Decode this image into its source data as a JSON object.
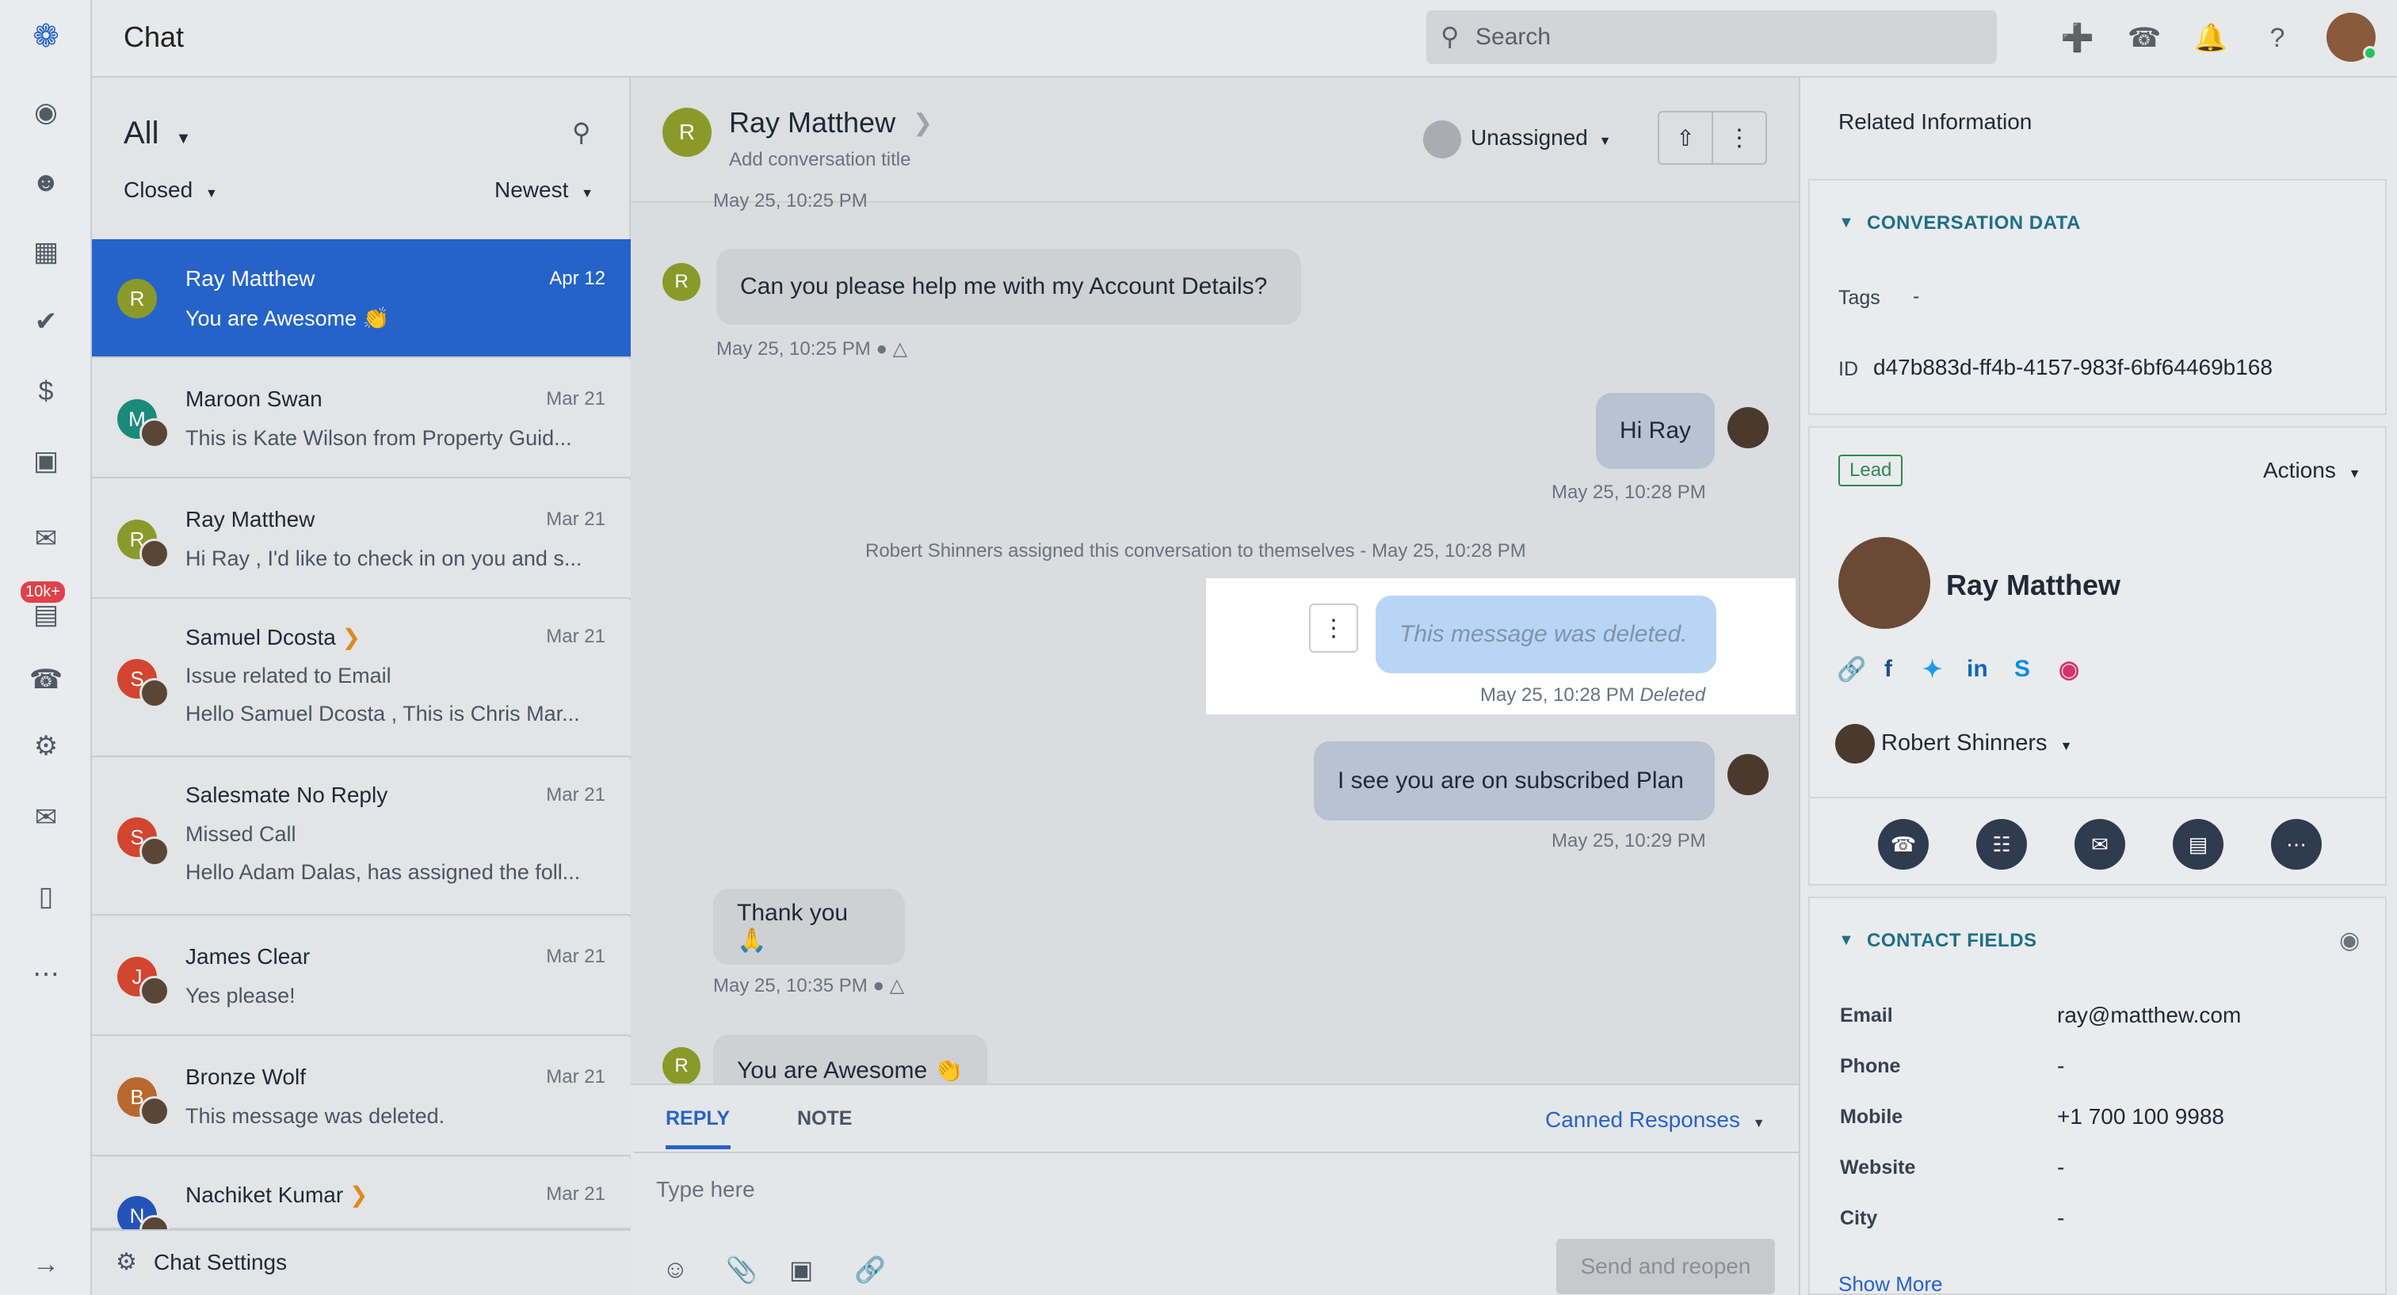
{
  "app": {
    "title": "Chat"
  },
  "search": {
    "placeholder": "Search"
  },
  "rail": {
    "badge": "10k+"
  },
  "list": {
    "filter": "All",
    "status": "Closed",
    "sort": "Newest",
    "settings": "Chat Settings",
    "items": [
      {
        "initial": "R",
        "name": "Ray Matthew",
        "date": "Apr 12",
        "line1": "You are Awesome 👏",
        "line2": "",
        "color": "#8a9a2a"
      },
      {
        "initial": "M",
        "name": "Maroon Swan",
        "date": "Mar 21",
        "line1": "This is Kate Wilson from Property Guid...",
        "line2": "",
        "color": "#1b8a7a"
      },
      {
        "initial": "R",
        "name": "Ray Matthew",
        "date": "Mar 21",
        "line1": "Hi Ray , I'd like to check in on you and s...",
        "line2": "",
        "color": "#8a9a2a"
      },
      {
        "initial": "S",
        "name": "Samuel Dcosta",
        "date": "Mar 21",
        "line1": "Issue related to Email",
        "line2": "Hello Samuel Dcosta , This is Chris Mar...",
        "color": "#d2452f"
      },
      {
        "initial": "S",
        "name": "Salesmate No Reply",
        "date": "Mar 21",
        "line1": "Missed Call",
        "line2": "Hello Adam Dalas, has assigned the foll...",
        "color": "#d2452f"
      },
      {
        "initial": "J",
        "name": "James Clear",
        "date": "Mar 21",
        "line1": "Yes please!",
        "line2": "",
        "color": "#d2452f"
      },
      {
        "initial": "B",
        "name": "Bronze Wolf",
        "date": "Mar 21",
        "line1": "This message was deleted.",
        "line2": "",
        "color": "#b8692d"
      },
      {
        "initial": "N",
        "name": "Nachiket Kumar",
        "date": "Mar 21",
        "line1": "",
        "line2": "",
        "color": "#2453b8"
      }
    ]
  },
  "chat": {
    "contact_initial": "R",
    "contact_name": "Ray Matthew",
    "title_placeholder": "Add conversation title",
    "assignee": "Unassigned",
    "top_meta": "May 25, 10:25 PM",
    "messages": {
      "m1": "Can you please help me with my Account Details?",
      "m1_meta": "May 25, 10:25 PM",
      "m2": "Hi Ray",
      "m2_meta": "May 25, 10:28 PM",
      "system": "Robert Shinners assigned this conversation to themselves - May 25, 10:28 PM",
      "deleted": "This message was deleted.",
      "deleted_meta": "May 25, 10:28 PM",
      "deleted_tag": "Deleted",
      "m3": "I see you are on subscribed Plan",
      "m3_meta": "May 25, 10:29 PM",
      "m4": "Thank you 🙏",
      "m4_meta": "May 25, 10:35 PM",
      "m5": "You are Awesome 👏"
    }
  },
  "reply": {
    "tab_reply": "REPLY",
    "tab_note": "NOTE",
    "canned": "Canned Responses",
    "placeholder": "Type here",
    "send": "Send and reopen"
  },
  "right": {
    "header": "Related Information",
    "conv_data_title": "CONVERSATION DATA",
    "tags_label": "Tags",
    "tags_value": "-",
    "id_label": "ID",
    "id_value": "d47b883d-ff4b-4157-983f-6bf64469b168",
    "lead_badge": "Lead",
    "actions": "Actions",
    "contact_name": "Ray Matthew",
    "owner": "Robert Shinners",
    "contact_fields_title": "CONTACT FIELDS",
    "fields": [
      {
        "label": "Email",
        "value": "ray@matthew.com"
      },
      {
        "label": "Phone",
        "value": "-"
      },
      {
        "label": "Mobile",
        "value": "+1 700 100 9988"
      },
      {
        "label": "Website",
        "value": "-"
      },
      {
        "label": "City",
        "value": "-"
      }
    ],
    "show_more": "Show More"
  },
  "colors": {
    "accent": "#2563c9",
    "teal": "#1e6f86",
    "lead": "#2f8a4e"
  }
}
